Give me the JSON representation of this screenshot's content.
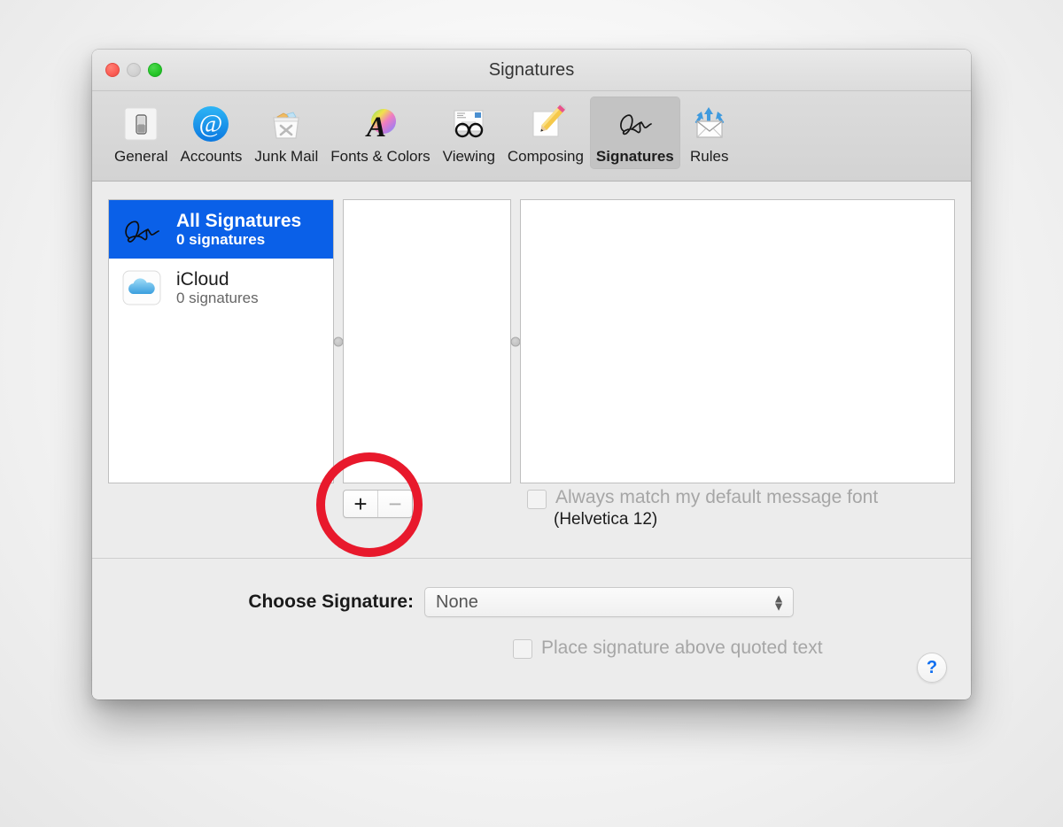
{
  "window": {
    "title": "Signatures",
    "traffic_lights": [
      {
        "name": "close",
        "color": "#fc6058"
      },
      {
        "name": "minimize",
        "color": "#d2d2d2"
      },
      {
        "name": "zoom",
        "color": "#28c82a"
      }
    ]
  },
  "toolbar": {
    "items": [
      {
        "label": "General",
        "icon": "general-switch-icon",
        "selected": false
      },
      {
        "label": "Accounts",
        "icon": "at-sign-icon",
        "selected": false
      },
      {
        "label": "Junk Mail",
        "icon": "trash-bin-icon",
        "selected": false
      },
      {
        "label": "Fonts & Colors",
        "icon": "font-colors-icon",
        "selected": false
      },
      {
        "label": "Viewing",
        "icon": "glasses-icon",
        "selected": false
      },
      {
        "label": "Composing",
        "icon": "pencil-note-icon",
        "selected": false
      },
      {
        "label": "Signatures",
        "icon": "signature-icon",
        "selected": true
      },
      {
        "label": "Rules",
        "icon": "envelope-arrows-icon",
        "selected": false
      }
    ]
  },
  "signature_list": {
    "rows": [
      {
        "title": "All Signatures",
        "subtitle": "0 signatures",
        "icon": "signature-icon",
        "selected": true
      },
      {
        "title": "iCloud",
        "subtitle": "0 signatures",
        "icon": "icloud-icon",
        "selected": false
      }
    ]
  },
  "signature_names_pane": {
    "items": []
  },
  "signature_editor_pane": {
    "content": ""
  },
  "controls": {
    "add_label": "+",
    "remove_label": "−",
    "font_match_label": "Always match my default message font",
    "font_match_checked": false,
    "font_note": "(Helvetica 12)"
  },
  "bottom": {
    "choose_label": "Choose Signature:",
    "choose_value": "None",
    "choose_options": [
      "None"
    ],
    "quoted_label": "Place signature above quoted text",
    "quoted_checked": false,
    "help_label": "?"
  },
  "annotation": {
    "type": "red-circle-highlight",
    "target": "add-signature-button",
    "color": "#e8192c"
  }
}
